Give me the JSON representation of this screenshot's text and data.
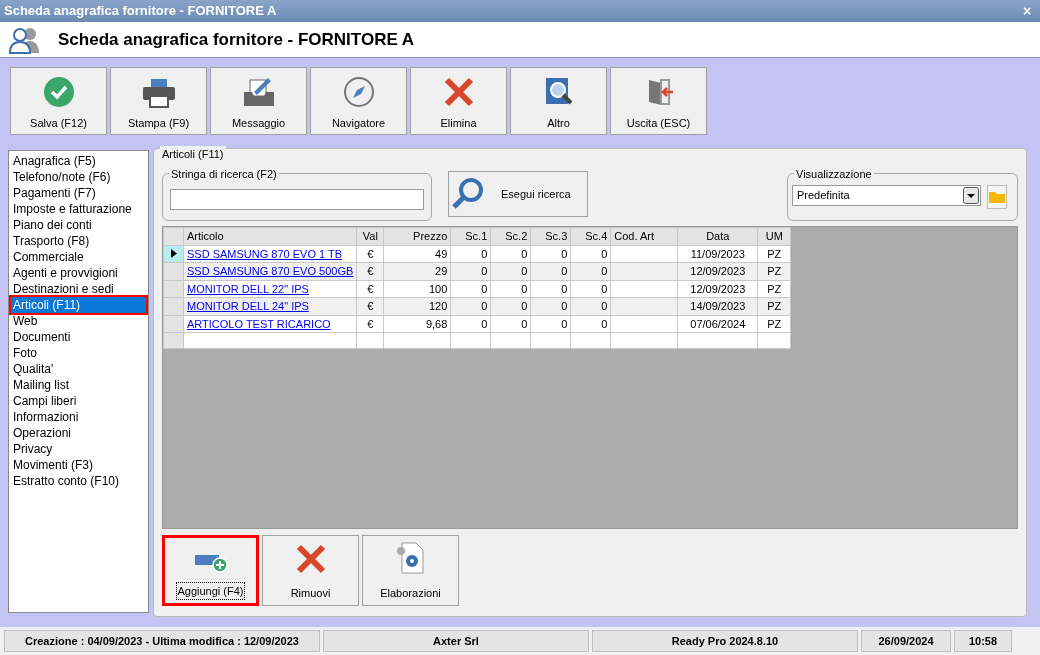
{
  "window": {
    "title": "Scheda anagrafica fornitore - FORNITORE A",
    "close": "×"
  },
  "header": {
    "title": "Scheda anagrafica fornitore - FORNITORE A"
  },
  "toolbar": [
    {
      "label": "Salva (F12)",
      "kind": "save"
    },
    {
      "label": "Stampa (F9)",
      "kind": "print"
    },
    {
      "label": "Messaggio",
      "kind": "message"
    },
    {
      "label": "Navigatore",
      "kind": "compass"
    },
    {
      "label": "Elimina",
      "kind": "delete"
    },
    {
      "label": "Altro",
      "kind": "more"
    },
    {
      "label": "Uscita (ESC)",
      "kind": "exit"
    }
  ],
  "sidebar": {
    "items": [
      {
        "label": "Anagrafica (F5)",
        "selected": false
      },
      {
        "label": "Telefono/note (F6)",
        "selected": false
      },
      {
        "label": "Pagamenti (F7)",
        "selected": false
      },
      {
        "label": "Imposte e fatturazione",
        "selected": false
      },
      {
        "label": "Piano dei conti",
        "selected": false
      },
      {
        "label": "Trasporto (F8)",
        "selected": false
      },
      {
        "label": "Commerciale",
        "selected": false
      },
      {
        "label": "Agenti e provvigioni",
        "selected": false
      },
      {
        "label": "Destinazioni e sedi",
        "selected": false
      },
      {
        "label": "Articoli (F11)",
        "selected": true
      },
      {
        "label": "Web",
        "selected": false
      },
      {
        "label": "Documenti",
        "selected": false
      },
      {
        "label": "Foto",
        "selected": false
      },
      {
        "label": "Qualita'",
        "selected": false
      },
      {
        "label": "Mailing list",
        "selected": false
      },
      {
        "label": "Campi liberi",
        "selected": false
      },
      {
        "label": "Informazioni",
        "selected": false
      },
      {
        "label": "Operazioni",
        "selected": false
      },
      {
        "label": "Privacy",
        "selected": false
      },
      {
        "label": "Movimenti (F3)",
        "selected": false
      },
      {
        "label": "Estratto conto (F10)",
        "selected": false
      }
    ]
  },
  "panel": {
    "title": "Articoli (F11)",
    "search": {
      "label": "Stringa di ricerca (F2)",
      "button": "Esegui ricerca"
    },
    "view": {
      "label": "Visualizzazione",
      "value": "Predefinita"
    },
    "table": {
      "columns": [
        "Articolo",
        "Val",
        "Prezzo",
        "Sc.1",
        "Sc.2",
        "Sc.3",
        "Sc.4",
        "Cod. Art",
        "Data",
        "UM"
      ],
      "rows": [
        {
          "current": true,
          "cells": [
            "SSD SAMSUNG 870 EVO 1 TB",
            "€",
            "49",
            "0",
            "0",
            "0",
            "0",
            "",
            "11/09/2023",
            "PZ"
          ]
        },
        {
          "current": false,
          "cells": [
            "SSD SAMSUNG 870 EVO 500GB",
            "€",
            "29",
            "0",
            "0",
            "0",
            "0",
            "",
            "12/09/2023",
            "PZ"
          ]
        },
        {
          "current": false,
          "cells": [
            "MONITOR DELL 22\" IPS",
            "€",
            "100",
            "0",
            "0",
            "0",
            "0",
            "",
            "12/09/2023",
            "PZ"
          ]
        },
        {
          "current": false,
          "cells": [
            "MONITOR DELL 24\" IPS",
            "€",
            "120",
            "0",
            "0",
            "0",
            "0",
            "",
            "14/09/2023",
            "PZ"
          ]
        },
        {
          "current": false,
          "cells": [
            "ARTICOLO TEST RICARICO",
            "€",
            "9,68",
            "0",
            "0",
            "0",
            "0",
            "",
            "07/06/2024",
            "PZ"
          ]
        }
      ]
    },
    "actions": [
      {
        "label": "Aggiungi (F4)",
        "kind": "add",
        "focused": true
      },
      {
        "label": "Rimuovi",
        "kind": "remove",
        "focused": false
      },
      {
        "label": "Elaborazioni",
        "kind": "process",
        "focused": false
      }
    ]
  },
  "status_bar": [
    "Creazione : 04/09/2023 - Ultima modifica : 12/09/2023",
    "Axter Srl",
    "Ready Pro 2024.8.10",
    "26/09/2024",
    "10:58"
  ]
}
